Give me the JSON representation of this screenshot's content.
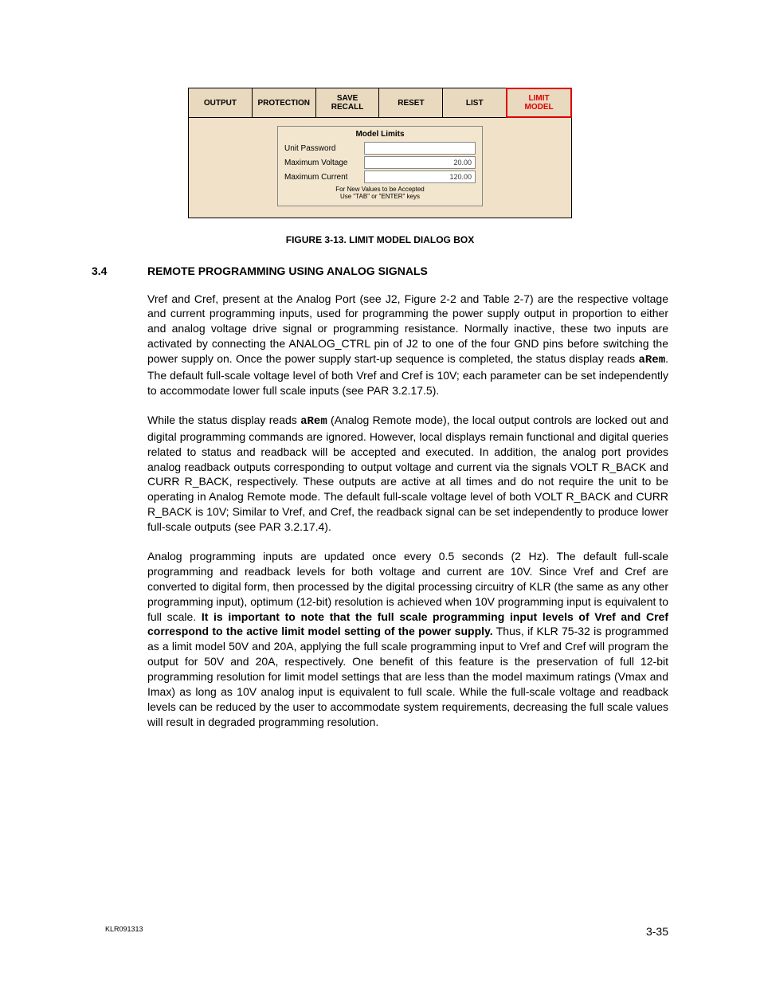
{
  "ui": {
    "toolbar": [
      "OUTPUT",
      "PROTECTION",
      "SAVE\nRECALL",
      "RESET",
      "LIST",
      "LIMIT\nMODEL"
    ],
    "panel_title": "Model Limits",
    "rows": [
      {
        "label": "Unit Password",
        "value": ""
      },
      {
        "label": "Maximum Voltage",
        "value": "20.00"
      },
      {
        "label": "Maximum Current",
        "value": "120.00"
      }
    ],
    "note_l1": "For New Values to be Accepted",
    "note_l2": "Use \"TAB\" or \"ENTER\" keys"
  },
  "figure_caption": "FIGURE 3-13.   LIMIT MODEL DIALOG BOX",
  "section": {
    "num": "3.4",
    "title": "REMOTE PROGRAMMING USING ANALOG SIGNALS"
  },
  "p1a": "Vref and Cref, present at the Analog Port (see J2, Figure 2-2 and Table 2-7) are the respective voltage and current programming inputs, used for programming the power supply output in proportion to either and analog voltage drive signal or programming resistance. Normally inactive, these two inputs are activated by connecting the ANALOG_CTRL pin of J2 to one of the four GND pins before switching the power supply on. Once the power supply start-up sequence is completed, the status display reads ",
  "p1_arem": "aRem",
  "p1b": ". The default full-scale voltage level of both Vref and Cref is 10V; each parameter can be set independently to accommodate lower full scale inputs (see PAR 3.2.17.5).",
  "p2a": "While the status display reads ",
  "p2_arem": "aRem",
  "p2b": " (Analog Remote mode), the local output controls are locked out and digital programming commands are ignored. However, local displays remain functional and digital queries related to status and readback will be accepted and executed. In addition, the analog port provides analog readback outputs corresponding to output voltage and current via the signals VOLT R_BACK and CURR R_BACK, respectively. These outputs are active at all times and do not require the unit to be operating in Analog Remote mode. The default full-scale voltage level of both VOLT R_BACK and CURR R_BACK is 10V; Similar to Vref, and Cref, the readback signal can be set independently to produce lower full-scale outputs (see PAR 3.2.17.4).",
  "p3a": "Analog programming inputs are updated once every 0.5 seconds (2 Hz). The default full-scale programming and readback levels for both voltage and current are 10V. Since Vref and Cref are converted to digital form, then processed by the digital processing circuitry of KLR (the same as any other programming input), optimum (12-bit) resolution is achieved when 10V programming input is equivalent to full scale. ",
  "p3_bold": "It is important to note that the full scale programming input levels of Vref and Cref correspond to the active limit model setting of the power supply.",
  "p3b": " Thus, if KLR 75-32 is programmed as a limit model 50V and 20A, applying the full scale programming input to Vref and Cref will program the output for 50V and 20A, respectively. One benefit of this feature is the preservation of full 12-bit programming resolution for limit model settings that are less than the model maximum ratings (Vmax and Imax) as long as 10V analog input is equivalent to full scale. While the full-scale voltage and readback levels can be reduced by the user to accommodate system requirements, decreasing the full scale values will result in degraded programming resolution.",
  "footer": {
    "docid": "KLR091313",
    "page": "3-35"
  }
}
